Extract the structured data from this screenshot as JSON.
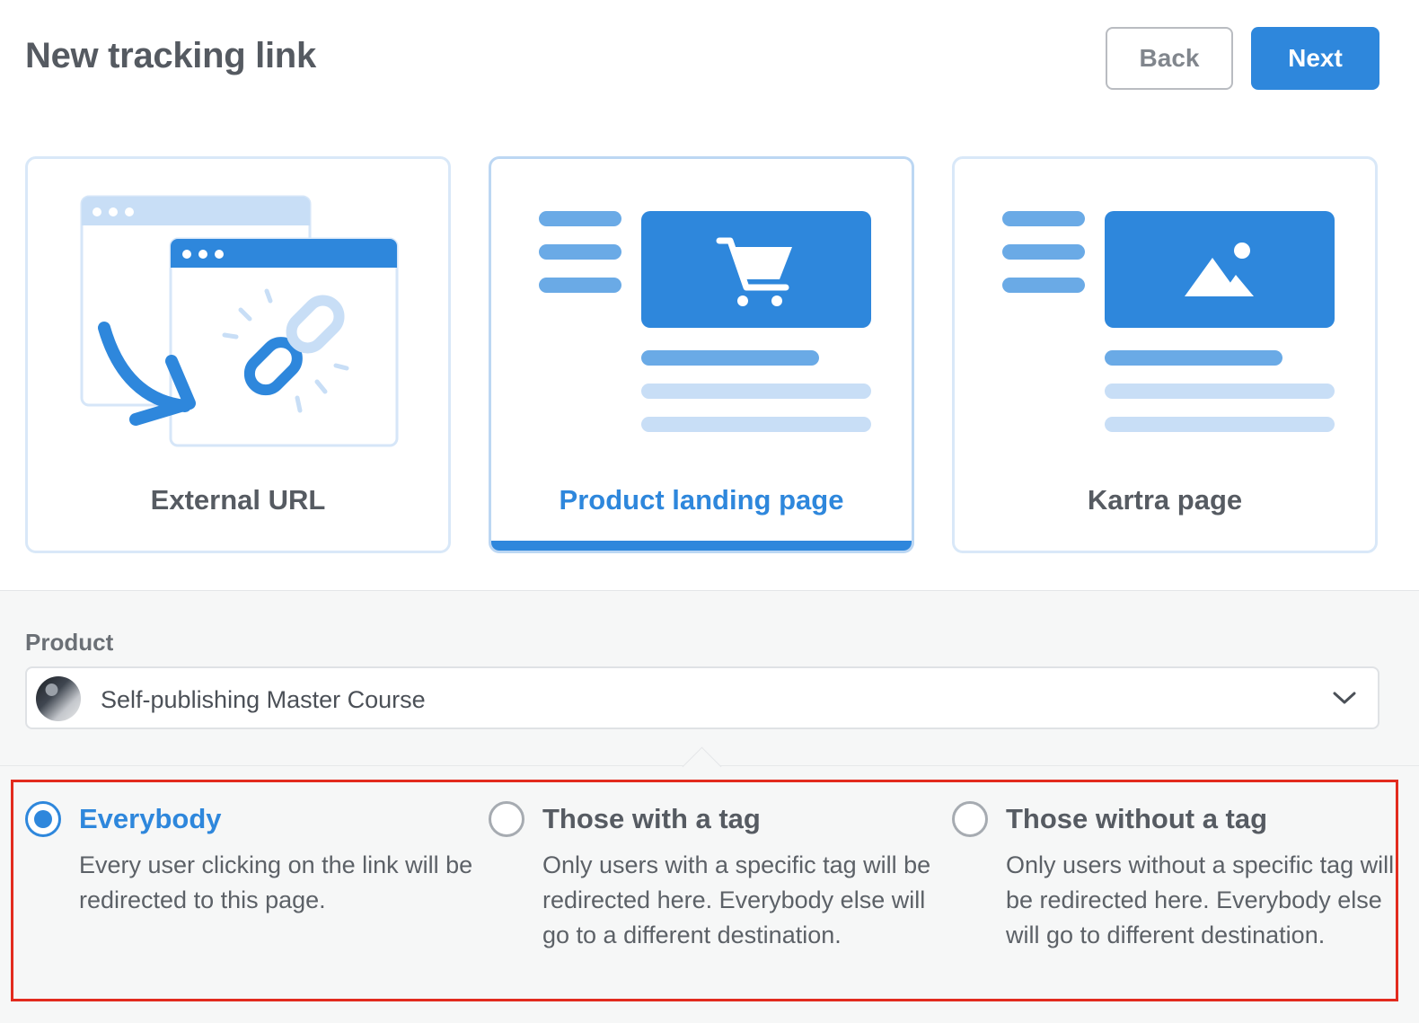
{
  "header": {
    "title": "New tracking link",
    "back_label": "Back",
    "next_label": "Next"
  },
  "link_types": [
    {
      "label": "External URL",
      "icon": "external-url-illustration",
      "selected": false
    },
    {
      "label": "Product landing page",
      "icon": "product-page-illustration",
      "selected": true
    },
    {
      "label": "Kartra page",
      "icon": "kartra-page-illustration",
      "selected": false
    }
  ],
  "product": {
    "label": "Product",
    "selected_value": "Self-publishing Master Course"
  },
  "audience_options": [
    {
      "title": "Everybody",
      "description": "Every user clicking on the link will be redirected to this page.",
      "selected": true
    },
    {
      "title": "Those with a tag",
      "description": "Only users with a specific tag will be redirected here. Everybody else will go to a different destination.",
      "selected": false
    },
    {
      "title": "Those without a tag",
      "description": "Only users without a specific tag will be redirected here. Everybody else will go to different destination.",
      "selected": false
    }
  ],
  "colors": {
    "accent": "#2e87dc",
    "highlight_border": "#e22b1e",
    "text": "#565b62"
  }
}
